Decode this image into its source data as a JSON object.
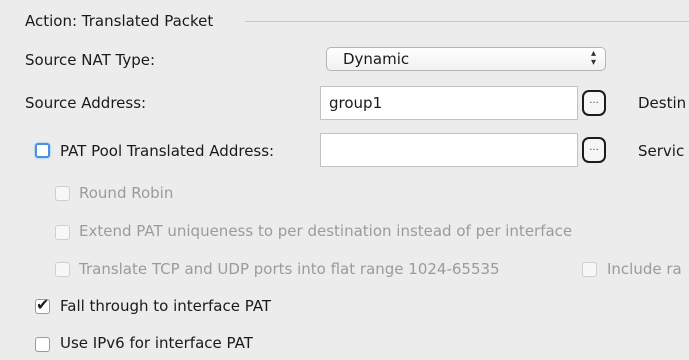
{
  "section": {
    "title": "Action: Translated Packet"
  },
  "source_nat_type": {
    "label": "Source NAT Type:",
    "value": "Dynamic",
    "arrows": "▴▾"
  },
  "source_address": {
    "label": "Source Address:",
    "value": "group1",
    "browse": "...",
    "right_label": "Destin"
  },
  "pat_pool": {
    "label": "PAT Pool Translated Address:",
    "value": "",
    "browse": "...",
    "right_label": "Servic",
    "checked": false
  },
  "round_robin": {
    "label": "Round Robin",
    "checked": false
  },
  "extend_pat": {
    "label": "Extend PAT uniqueness to per destination instead of per interface",
    "checked": false
  },
  "translate_ports": {
    "label": "Translate TCP and UDP ports into flat range 1024-65535",
    "checked": false
  },
  "include_reserve": {
    "label": "Include ra",
    "checked": false
  },
  "fall_through": {
    "label": "Fall through to interface PAT",
    "checked": true,
    "tick": "✔"
  },
  "use_ipv6": {
    "label": "Use IPv6 for interface PAT",
    "checked": false
  }
}
